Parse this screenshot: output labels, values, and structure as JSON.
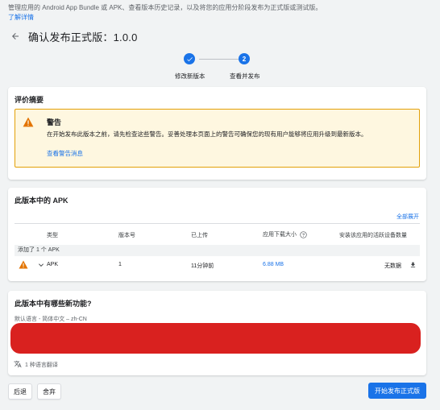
{
  "intro": {
    "text": "管理应用的 Android App Bundle 或 APK、查看版本历史记录，以及将您的应用分阶段发布为正式版或测试版。",
    "link": "了解详情"
  },
  "header": {
    "title": "确认发布正式版：1.0.0"
  },
  "stepper": {
    "steps": [
      {
        "label": "修改新版本",
        "state": "done"
      },
      {
        "number": "2",
        "label": "查看并发布",
        "state": "current"
      }
    ]
  },
  "review": {
    "title": "评价摘要",
    "warning": {
      "title": "警告",
      "text": "在开始发布此版本之前，请先检查这些警告。妥善处理本页面上的警告可确保您的现有用户能够将应用升级到最新版本。",
      "link": "查看警告消息"
    }
  },
  "apks": {
    "title": "此版本中的 APK",
    "expand_all": "全部展开",
    "columns": {
      "type": "类型",
      "version": "版本号",
      "uploaded": "已上传",
      "size": "应用下载大小",
      "devices": "安装该应用的活跃设备数量"
    },
    "group": "添加了 1 个 APK",
    "rows": [
      {
        "type": "APK",
        "version": "1",
        "uploaded": "11分钟前",
        "size": "6.88 MB",
        "devices": "无数据"
      }
    ]
  },
  "whats_new": {
    "title": "此版本中有哪些新功能?",
    "language": "默认语言 - 简体中文 – zh-CN",
    "translations": "1 种语言翻译"
  },
  "footer": {
    "back": "后退",
    "discard": "舍弃",
    "start_rollout": "开始发布正式版"
  },
  "colors": {
    "accent": "#1a73e8",
    "warning": "#e37400",
    "redacted": "#d9211f"
  }
}
